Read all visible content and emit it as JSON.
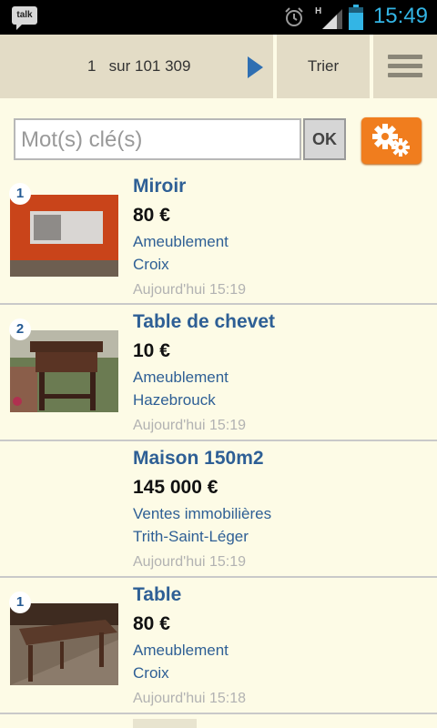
{
  "status_bar": {
    "talk_label": "talk",
    "signal_label": "H",
    "time": "15:49",
    "accent_color": "#33b5e5"
  },
  "top_bar": {
    "page_current": "1",
    "page_separator": "sur",
    "page_total": "101 309",
    "sort_label": "Trier",
    "background": "#e3dcc6"
  },
  "search": {
    "placeholder": "Mot(s) clé(s)",
    "value": "",
    "ok_label": "OK",
    "settings_color": "#f07d1e"
  },
  "listings": [
    {
      "badge": "1",
      "title": "Miroir",
      "price": "80 €",
      "category": "Ameublement",
      "city": "Croix",
      "date": "Aujourd'hui 15:19",
      "thumb": "mirror-photo"
    },
    {
      "badge": "2",
      "title": "Table de chevet",
      "price": "10 €",
      "category": "Ameublement",
      "city": "Hazebrouck",
      "date": "Aujourd'hui 15:19",
      "thumb": "nightstand-photo"
    },
    {
      "badge": "",
      "title": "Maison 150m2",
      "price": "145 000 €",
      "category": "Ventes immobilières",
      "city": "Trith-Saint-Léger",
      "date": "Aujourd'hui 15:19",
      "thumb": ""
    },
    {
      "badge": "1",
      "title": "Table",
      "price": "80 €",
      "category": "Ameublement",
      "city": "Croix",
      "date": "Aujourd'hui 15:18",
      "thumb": "table-photo"
    }
  ]
}
